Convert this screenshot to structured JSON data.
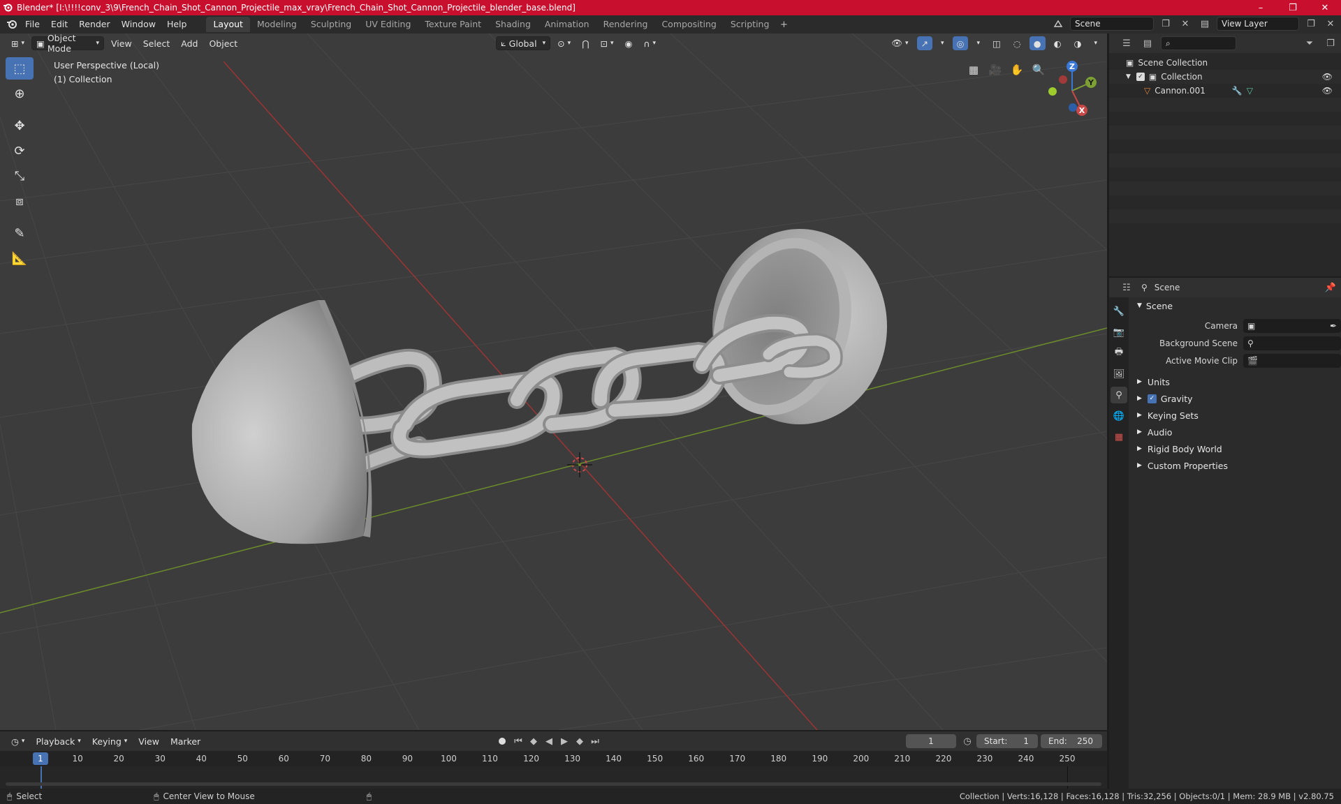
{
  "window": {
    "title": "Blender* [I:\\!!!!conv_3\\9\\French_Chain_Shot_Cannon_Projectile_max_vray\\French_Chain_Shot_Cannon_Projectile_blender_base.blend]",
    "minimize": "–",
    "maximize": "❐",
    "close": "✕"
  },
  "menu": [
    "File",
    "Edit",
    "Render",
    "Window",
    "Help"
  ],
  "workspaces": [
    "Layout",
    "Modeling",
    "Sculpting",
    "UV Editing",
    "Texture Paint",
    "Shading",
    "Animation",
    "Rendering",
    "Compositing",
    "Scripting"
  ],
  "active_workspace": "Layout",
  "scene_selector": "Scene",
  "view_layer_selector": "View Layer",
  "viewport": {
    "mode": "Object Mode",
    "menus": [
      "View",
      "Select",
      "Add",
      "Object"
    ],
    "transform_orientation": "Global",
    "info_line1": "User Perspective (Local)",
    "info_line2": "(1) Collection",
    "gizmo_axes": [
      "Z",
      "Y",
      "X"
    ],
    "colors": {
      "background": "#3c3c3c",
      "x_axis": "#9d3434",
      "y_axis": "#6b8c2a",
      "mesh": "#b7b7b7",
      "active_blue": "#4772b3"
    }
  },
  "outliner": {
    "root": "Scene Collection",
    "collection": "Collection",
    "object": "Cannon.001"
  },
  "properties": {
    "context": "Scene",
    "panel": "Scene",
    "fields": [
      {
        "label": "Camera",
        "value": ""
      },
      {
        "label": "Background Scene",
        "value": ""
      },
      {
        "label": "Active Movie Clip",
        "value": ""
      }
    ],
    "subpanels": [
      "Units",
      "Gravity",
      "Keying Sets",
      "Audio",
      "Rigid Body World",
      "Custom Properties"
    ],
    "gravity_checked": true
  },
  "timeline": {
    "menus": [
      "Playback",
      "Keying",
      "View",
      "Marker"
    ],
    "current_frame": "1",
    "start_label": "Start:",
    "start": "1",
    "end_label": "End:",
    "end": "250",
    "ruler": [
      10,
      20,
      30,
      40,
      50,
      60,
      70,
      80,
      90,
      100,
      110,
      120,
      130,
      140,
      150,
      160,
      170,
      180,
      190,
      200,
      210,
      220,
      230,
      240,
      250
    ],
    "ruler_current": "1"
  },
  "status": {
    "select": "Select",
    "center_view": "Center View to Mouse",
    "stats": "Collection | Verts:16,128 | Faces:16,128 | Tris:32,256 | Objects:0/1 | Mem: 28.9 MB | v2.80.75"
  }
}
